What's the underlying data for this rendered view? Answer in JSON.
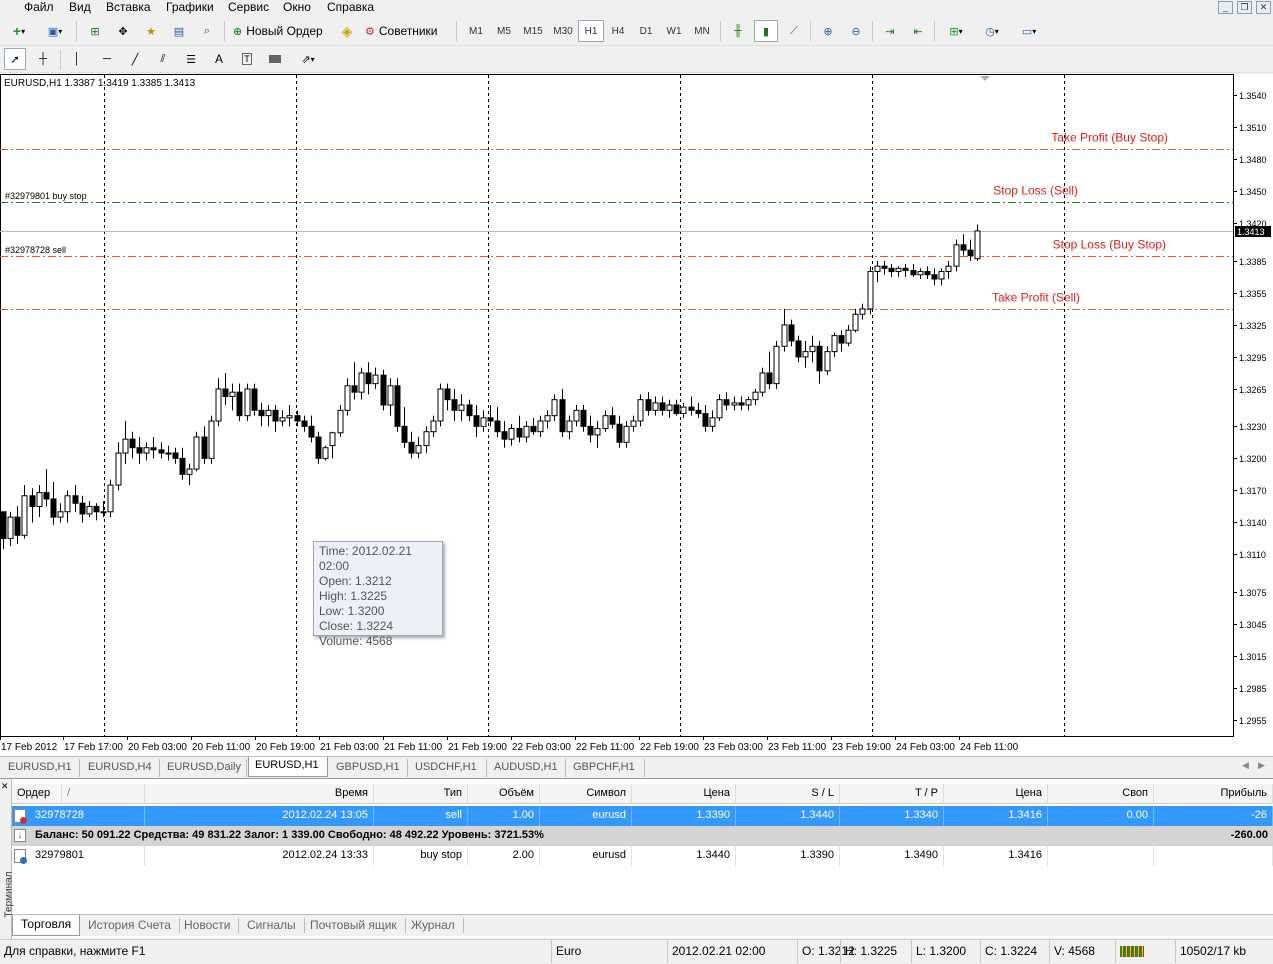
{
  "menu": [
    "Файл",
    "Вид",
    "Вставка",
    "Графики",
    "Сервис",
    "Окно",
    "Справка"
  ],
  "toolbar": {
    "new_order": "Новый Ордер",
    "experts": "Советники",
    "timeframes": [
      "M1",
      "M5",
      "M15",
      "M30",
      "H1",
      "H4",
      "D1",
      "W1",
      "MN"
    ],
    "active_tf": "H1"
  },
  "chart": {
    "header": "EURUSD,H1  1.3387 1.3419 1.3385 1.3413",
    "price_labels": [
      "1.3540",
      "1.3510",
      "1.3480",
      "1.3450",
      "1.3420",
      "1.3385",
      "1.3355",
      "1.3325",
      "1.3295",
      "1.3265",
      "1.3230",
      "1.3200",
      "1.3170",
      "1.3140",
      "1.3110",
      "1.3075",
      "1.3045",
      "1.3015",
      "1.2985",
      "1.2955"
    ],
    "current_price": "1.3413",
    "time_labels": [
      "17 Feb 2012",
      "17 Feb 17:00",
      "20 Feb 03:00",
      "20 Feb 11:00",
      "20 Feb 19:00",
      "21 Feb 03:00",
      "21 Feb 11:00",
      "21 Feb 19:00",
      "22 Feb 03:00",
      "22 Feb 11:00",
      "22 Feb 19:00",
      "23 Feb 03:00",
      "23 Feb 11:00",
      "23 Feb 19:00",
      "24 Feb 03:00",
      "24 Feb 11:00"
    ],
    "levels": [
      {
        "label": "Take Profit (Buy Stop)",
        "price": 1.349,
        "color": "#e06020",
        "text_color": "#e02020"
      },
      {
        "label": "Stop Loss (Sell)",
        "price": 1.344,
        "color": "#208020",
        "text_color": "#e02020"
      },
      {
        "label": "Stop Loss (Buy Stop)",
        "price": 1.339,
        "color": "#e06020",
        "text_color": "#e02020"
      },
      {
        "label": "Take Profit (Sell)",
        "price": 1.334,
        "color": "#e06020",
        "text_color": "#e02020"
      }
    ],
    "order_tags": [
      {
        "label": "#32979801 buy stop",
        "price": 1.344
      },
      {
        "label": "#32978728 sell",
        "price": 1.339
      }
    ],
    "tooltip": [
      "Time: 2012.02.21 02:00",
      "Open: 1.3212",
      "High: 1.3225",
      "Low:  1.3200",
      "Close: 1.3224",
      "Volume: 4568"
    ]
  },
  "chart_data": {
    "type": "candlestick",
    "symbol": "EURUSD,H1",
    "ylim": [
      1.294,
      1.356
    ],
    "ohlc": [
      [
        1.315,
        1.315,
        1.3115,
        1.3125
      ],
      [
        1.3125,
        1.315,
        1.3118,
        1.3145
      ],
      [
        1.3145,
        1.3155,
        1.312,
        1.3128
      ],
      [
        1.3128,
        1.3175,
        1.3125,
        1.3165
      ],
      [
        1.3165,
        1.3172,
        1.314,
        1.3155
      ],
      [
        1.3155,
        1.3175,
        1.3145,
        1.3168
      ],
      [
        1.3168,
        1.319,
        1.3155,
        1.3162
      ],
      [
        1.3162,
        1.3178,
        1.3138,
        1.3145
      ],
      [
        1.3145,
        1.3158,
        1.314,
        1.315
      ],
      [
        1.315,
        1.317,
        1.314,
        1.3165
      ],
      [
        1.3165,
        1.3175,
        1.315,
        1.3158
      ],
      [
        1.3158,
        1.3165,
        1.314,
        1.3148
      ],
      [
        1.3148,
        1.316,
        1.3145,
        1.3155
      ],
      [
        1.3155,
        1.3158,
        1.3142,
        1.315
      ],
      [
        1.315,
        1.316,
        1.3145,
        1.315
      ],
      [
        1.315,
        1.318,
        1.3145,
        1.3175
      ],
      [
        1.3175,
        1.3215,
        1.317,
        1.3205
      ],
      [
        1.3205,
        1.3235,
        1.3195,
        1.3218
      ],
      [
        1.3218,
        1.3225,
        1.32,
        1.321
      ],
      [
        1.321,
        1.322,
        1.3195,
        1.3205
      ],
      [
        1.3205,
        1.3215,
        1.3198,
        1.321
      ],
      [
        1.321,
        1.322,
        1.32,
        1.3208
      ],
      [
        1.3208,
        1.3215,
        1.32,
        1.3205
      ],
      [
        1.3205,
        1.3212,
        1.3198,
        1.3205
      ],
      [
        1.3205,
        1.321,
        1.3195,
        1.32
      ],
      [
        1.32,
        1.321,
        1.318,
        1.3185
      ],
      [
        1.3185,
        1.3195,
        1.3175,
        1.319
      ],
      [
        1.319,
        1.3225,
        1.3188,
        1.322
      ],
      [
        1.322,
        1.323,
        1.3195,
        1.32
      ],
      [
        1.32,
        1.324,
        1.3195,
        1.3235
      ],
      [
        1.3235,
        1.3275,
        1.323,
        1.3265
      ],
      [
        1.3265,
        1.328,
        1.325,
        1.3258
      ],
      [
        1.3258,
        1.327,
        1.3245,
        1.3262
      ],
      [
        1.3262,
        1.327,
        1.3235,
        1.324
      ],
      [
        1.324,
        1.327,
        1.3235,
        1.3265
      ],
      [
        1.3265,
        1.327,
        1.324,
        1.3245
      ],
      [
        1.3245,
        1.3252,
        1.323,
        1.324
      ],
      [
        1.324,
        1.325,
        1.323,
        1.3245
      ],
      [
        1.3245,
        1.325,
        1.3225,
        1.3235
      ],
      [
        1.3235,
        1.3245,
        1.323,
        1.3238
      ],
      [
        1.3238,
        1.325,
        1.323,
        1.324
      ],
      [
        1.324,
        1.3245,
        1.323,
        1.3235
      ],
      [
        1.3235,
        1.324,
        1.3225,
        1.323
      ],
      [
        1.323,
        1.324,
        1.3215,
        1.322
      ],
      [
        1.322,
        1.3225,
        1.3195,
        1.32
      ],
      [
        1.32,
        1.3212,
        1.3198,
        1.321
      ],
      [
        1.3212,
        1.3225,
        1.32,
        1.3224
      ],
      [
        1.3224,
        1.325,
        1.322,
        1.3245
      ],
      [
        1.3245,
        1.3275,
        1.324,
        1.3268
      ],
      [
        1.3268,
        1.329,
        1.3255,
        1.3262
      ],
      [
        1.3262,
        1.3285,
        1.3255,
        1.328
      ],
      [
        1.328,
        1.329,
        1.326,
        1.327
      ],
      [
        1.327,
        1.3285,
        1.3265,
        1.3278
      ],
      [
        1.3278,
        1.3283,
        1.3245,
        1.325
      ],
      [
        1.325,
        1.3275,
        1.324,
        1.3268
      ],
      [
        1.3268,
        1.3275,
        1.3225,
        1.323
      ],
      [
        1.323,
        1.3248,
        1.321,
        1.3215
      ],
      [
        1.3215,
        1.3225,
        1.32,
        1.3205
      ],
      [
        1.3205,
        1.322,
        1.32,
        1.3212
      ],
      [
        1.3212,
        1.323,
        1.3205,
        1.3225
      ],
      [
        1.3225,
        1.324,
        1.322,
        1.3235
      ],
      [
        1.3235,
        1.327,
        1.323,
        1.3265
      ],
      [
        1.3265,
        1.327,
        1.3245,
        1.3255
      ],
      [
        1.3255,
        1.3265,
        1.3235,
        1.3245
      ],
      [
        1.3245,
        1.326,
        1.3235,
        1.325
      ],
      [
        1.325,
        1.3255,
        1.3235,
        1.324
      ],
      [
        1.324,
        1.325,
        1.322,
        1.323
      ],
      [
        1.323,
        1.3245,
        1.3225,
        1.3238
      ],
      [
        1.3238,
        1.325,
        1.323,
        1.3235
      ],
      [
        1.3235,
        1.3248,
        1.322,
        1.3225
      ],
      [
        1.3225,
        1.3235,
        1.321,
        1.3218
      ],
      [
        1.3218,
        1.3232,
        1.3212,
        1.3228
      ],
      [
        1.3228,
        1.324,
        1.3215,
        1.322
      ],
      [
        1.322,
        1.3235,
        1.3215,
        1.323
      ],
      [
        1.323,
        1.3238,
        1.3222,
        1.3225
      ],
      [
        1.3225,
        1.324,
        1.322,
        1.3235
      ],
      [
        1.3235,
        1.3245,
        1.3228,
        1.324
      ],
      [
        1.324,
        1.326,
        1.3235,
        1.3255
      ],
      [
        1.3255,
        1.3265,
        1.322,
        1.3225
      ],
      [
        1.3225,
        1.324,
        1.3218,
        1.3235
      ],
      [
        1.3235,
        1.325,
        1.323,
        1.3245
      ],
      [
        1.3245,
        1.325,
        1.3225,
        1.323
      ],
      [
        1.323,
        1.324,
        1.3215,
        1.3222
      ],
      [
        1.3222,
        1.3235,
        1.321,
        1.3228
      ],
      [
        1.3228,
        1.3245,
        1.3225,
        1.324
      ],
      [
        1.324,
        1.3248,
        1.3228,
        1.3232
      ],
      [
        1.3232,
        1.324,
        1.321,
        1.3215
      ],
      [
        1.3215,
        1.3235,
        1.321,
        1.323
      ],
      [
        1.323,
        1.324,
        1.3225,
        1.3235
      ],
      [
        1.3235,
        1.326,
        1.323,
        1.3255
      ],
      [
        1.3255,
        1.3262,
        1.324,
        1.3245
      ],
      [
        1.3245,
        1.3258,
        1.324,
        1.3252
      ],
      [
        1.3252,
        1.3258,
        1.324,
        1.3245
      ],
      [
        1.3245,
        1.3255,
        1.3238,
        1.325
      ],
      [
        1.325,
        1.3255,
        1.324,
        1.3242
      ],
      [
        1.3242,
        1.3252,
        1.3238,
        1.3248
      ],
      [
        1.3248,
        1.3258,
        1.324,
        1.3245
      ],
      [
        1.3245,
        1.3252,
        1.3238,
        1.3242
      ],
      [
        1.3242,
        1.325,
        1.3225,
        1.323
      ],
      [
        1.323,
        1.3245,
        1.3225,
        1.3238
      ],
      [
        1.3238,
        1.326,
        1.3235,
        1.3255
      ],
      [
        1.3255,
        1.3262,
        1.3245,
        1.325
      ],
      [
        1.325,
        1.3258,
        1.3245,
        1.3252
      ],
      [
        1.3252,
        1.3258,
        1.3245,
        1.325
      ],
      [
        1.325,
        1.3258,
        1.3245,
        1.3255
      ],
      [
        1.3255,
        1.3265,
        1.325,
        1.3262
      ],
      [
        1.3262,
        1.3285,
        1.3258,
        1.328
      ],
      [
        1.328,
        1.33,
        1.3265,
        1.327
      ],
      [
        1.327,
        1.331,
        1.3265,
        1.3305
      ],
      [
        1.3305,
        1.334,
        1.33,
        1.3325
      ],
      [
        1.3325,
        1.333,
        1.3305,
        1.331
      ],
      [
        1.331,
        1.3315,
        1.329,
        1.3295
      ],
      [
        1.3295,
        1.331,
        1.3285,
        1.33
      ],
      [
        1.33,
        1.3315,
        1.329,
        1.3305
      ],
      [
        1.3305,
        1.331,
        1.327,
        1.3282
      ],
      [
        1.3282,
        1.3305,
        1.3278,
        1.33
      ],
      [
        1.33,
        1.3318,
        1.3295,
        1.3315
      ],
      [
        1.3315,
        1.332,
        1.33,
        1.3308
      ],
      [
        1.3308,
        1.3325,
        1.3305,
        1.332
      ],
      [
        1.332,
        1.334,
        1.3318,
        1.3335
      ],
      [
        1.3335,
        1.3345,
        1.333,
        1.334
      ],
      [
        1.334,
        1.338,
        1.3335,
        1.3375
      ],
      [
        1.3375,
        1.3385,
        1.3365,
        1.338
      ],
      [
        1.338,
        1.3385,
        1.3372,
        1.3378
      ],
      [
        1.3378,
        1.3382,
        1.337,
        1.3375
      ],
      [
        1.3375,
        1.338,
        1.337,
        1.3378
      ],
      [
        1.3378,
        1.3382,
        1.337,
        1.3376
      ],
      [
        1.3376,
        1.3382,
        1.337,
        1.3372
      ],
      [
        1.3372,
        1.3378,
        1.3368,
        1.3375
      ],
      [
        1.3375,
        1.338,
        1.3368,
        1.3372
      ],
      [
        1.3372,
        1.3378,
        1.3362,
        1.3368
      ],
      [
        1.3368,
        1.3378,
        1.3362,
        1.3375
      ],
      [
        1.3375,
        1.3385,
        1.3368,
        1.338
      ],
      [
        1.338,
        1.3405,
        1.3375,
        1.34
      ],
      [
        1.34,
        1.341,
        1.339,
        1.3395
      ],
      [
        1.3395,
        1.3405,
        1.3385,
        1.339
      ],
      [
        1.3387,
        1.3419,
        1.3385,
        1.3413
      ]
    ]
  },
  "chart_tabs": [
    "EURUSD,H1",
    "EURUSD,H4",
    "EURUSD,Daily",
    "EURUSD,H1",
    "GBPUSD,H1",
    "USDCHF,H1",
    "AUDUSD,H1",
    "GBPCHF,H1"
  ],
  "chart_tab_active": 3,
  "terminal": {
    "side_label": "Терминал",
    "headers": [
      "Ордер",
      "/",
      "Время",
      "Тип",
      "Объём",
      "Символ",
      "Цена",
      "S / L",
      "T / P",
      "Цена",
      "Своп",
      "Прибыль"
    ],
    "rows": [
      [
        "32978728",
        "2012.02.24 13:05",
        "sell",
        "1.00",
        "eurusd",
        "1.3390",
        "1.3440",
        "1.3340",
        "1.3416",
        "0.00",
        "-26"
      ],
      [
        "32979801",
        "2012.02.24 13:33",
        "buy stop",
        "2.00",
        "eurusd",
        "1.3440",
        "1.3390",
        "1.3490",
        "1.3416",
        "",
        ""
      ]
    ],
    "balance_line": "Баланс: 50 091.22  Средства: 49 831.22  Залог: 1 339.00  Свободно: 48 492.22  Уровень: 3721.53%",
    "balance_profit": "-260.00",
    "tabs": [
      "Торговля",
      "История Счета",
      "Новости",
      "Сигналы",
      "Почтовый ящик",
      "Журнал"
    ]
  },
  "status": {
    "help": "Для справки, нажмите F1",
    "profile": "Euro",
    "time": "2012.02.21 02:00",
    "open": "O: 1.3212",
    "high": "H: 1.3225",
    "low": "L: 1.3200",
    "close": "C: 1.3224",
    "volume": "V: 4568",
    "traffic": "10502/17 kb"
  }
}
